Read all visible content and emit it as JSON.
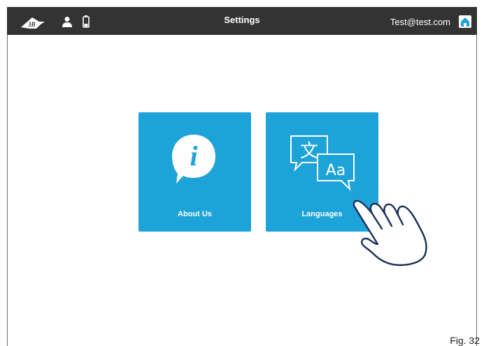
{
  "header": {
    "title": "Settings",
    "email": "Test@test.com"
  },
  "tiles": [
    {
      "label": "About Us",
      "icon": "info-bubble-icon"
    },
    {
      "label": "Languages",
      "icon": "translate-bubbles-icon",
      "glyph_a": "文",
      "glyph_b": "Aa"
    }
  ],
  "figure_label": "Fig. 32",
  "colors": {
    "topbar": "#333333",
    "tile": "#1ea3d8",
    "home_icon": "#1ea3d8"
  }
}
